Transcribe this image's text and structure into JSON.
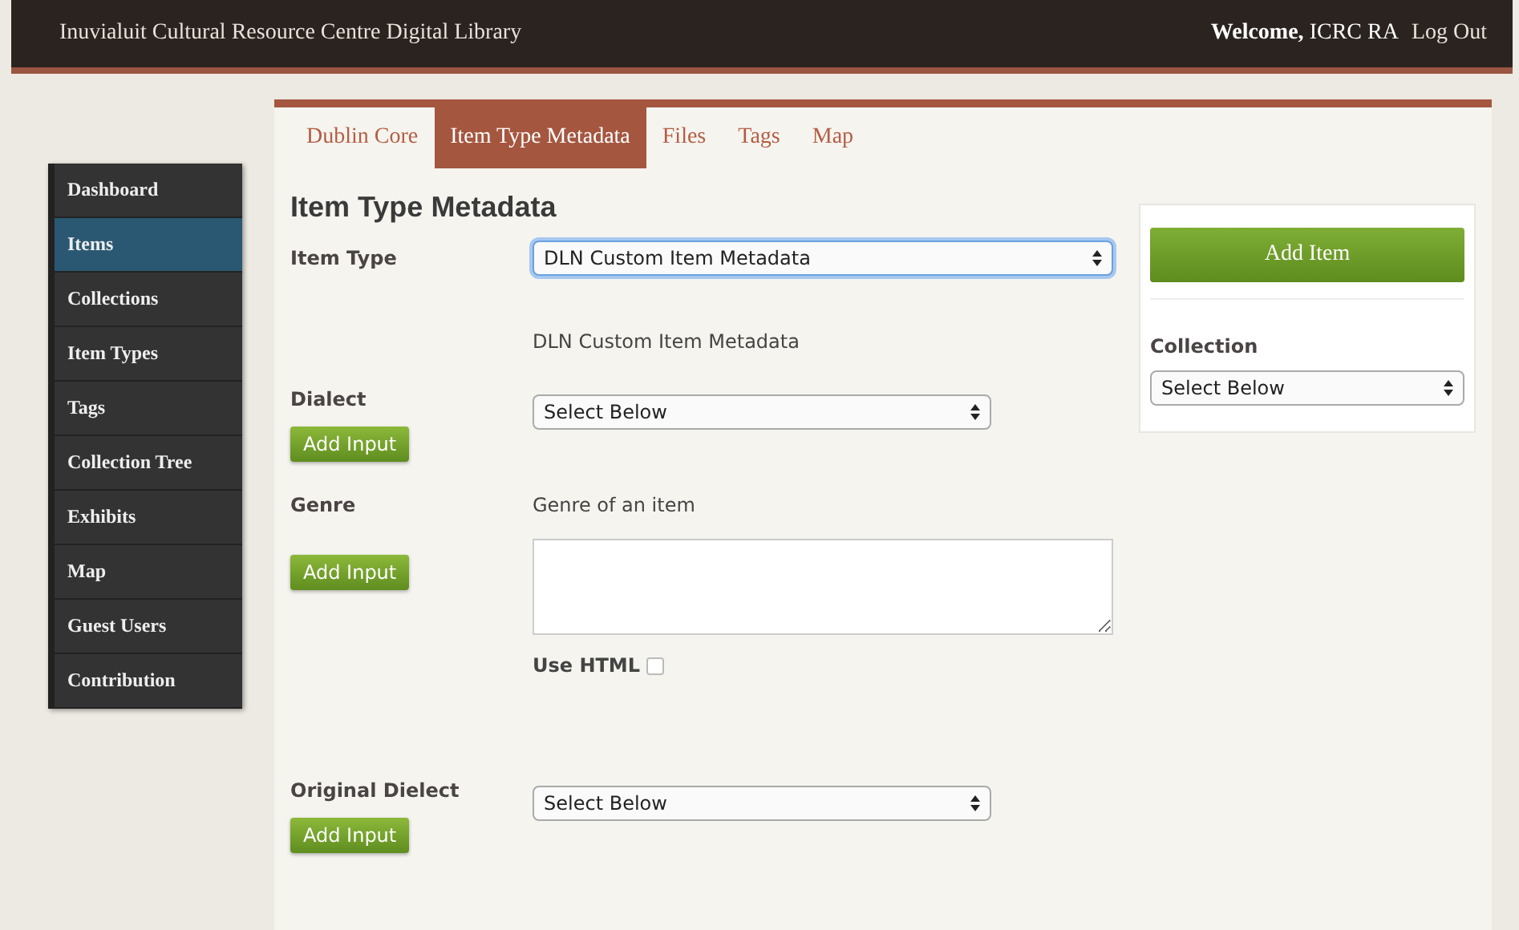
{
  "header": {
    "title": "Inuvialuit Cultural Resource Centre Digital Library",
    "welcome": "Welcome,",
    "user": "ICRC RA",
    "logout": "Log Out"
  },
  "sidebar": {
    "items": [
      {
        "label": "Dashboard",
        "selected": false
      },
      {
        "label": "Items",
        "selected": true
      },
      {
        "label": "Collections",
        "selected": false
      },
      {
        "label": "Item Types",
        "selected": false
      },
      {
        "label": "Tags",
        "selected": false
      },
      {
        "label": "Collection Tree",
        "selected": false
      },
      {
        "label": "Exhibits",
        "selected": false
      },
      {
        "label": "Map",
        "selected": false
      },
      {
        "label": "Guest Users",
        "selected": false
      },
      {
        "label": "Contribution",
        "selected": false
      }
    ]
  },
  "tabs": [
    {
      "label": "Dublin Core",
      "selected": false
    },
    {
      "label": "Item Type Metadata",
      "selected": true
    },
    {
      "label": "Files",
      "selected": false
    },
    {
      "label": "Tags",
      "selected": false
    },
    {
      "label": "Map",
      "selected": false
    }
  ],
  "heading": "Item Type Metadata",
  "fields": [
    {
      "kind": "select",
      "label": "Item Type",
      "value": "DLN Custom Item Metadata",
      "focused": true,
      "wide": true,
      "note": "DLN Custom Item Metadata"
    },
    {
      "kind": "select",
      "label": "Dialect",
      "value": "Select Below",
      "focused": false,
      "wide": false,
      "button": "Add Input"
    },
    {
      "kind": "textarea",
      "label": "Genre",
      "description": "Genre of an item",
      "button": "Add Input",
      "use_html": {
        "label": "Use HTML",
        "checked": false
      }
    },
    {
      "kind": "select",
      "label": "Original Dielect",
      "value": "Select Below",
      "focused": false,
      "wide": false,
      "button": "Add Input"
    }
  ],
  "aside": {
    "button": "Add Item",
    "collection_label": "Collection",
    "collection_value": "Select Below"
  }
}
